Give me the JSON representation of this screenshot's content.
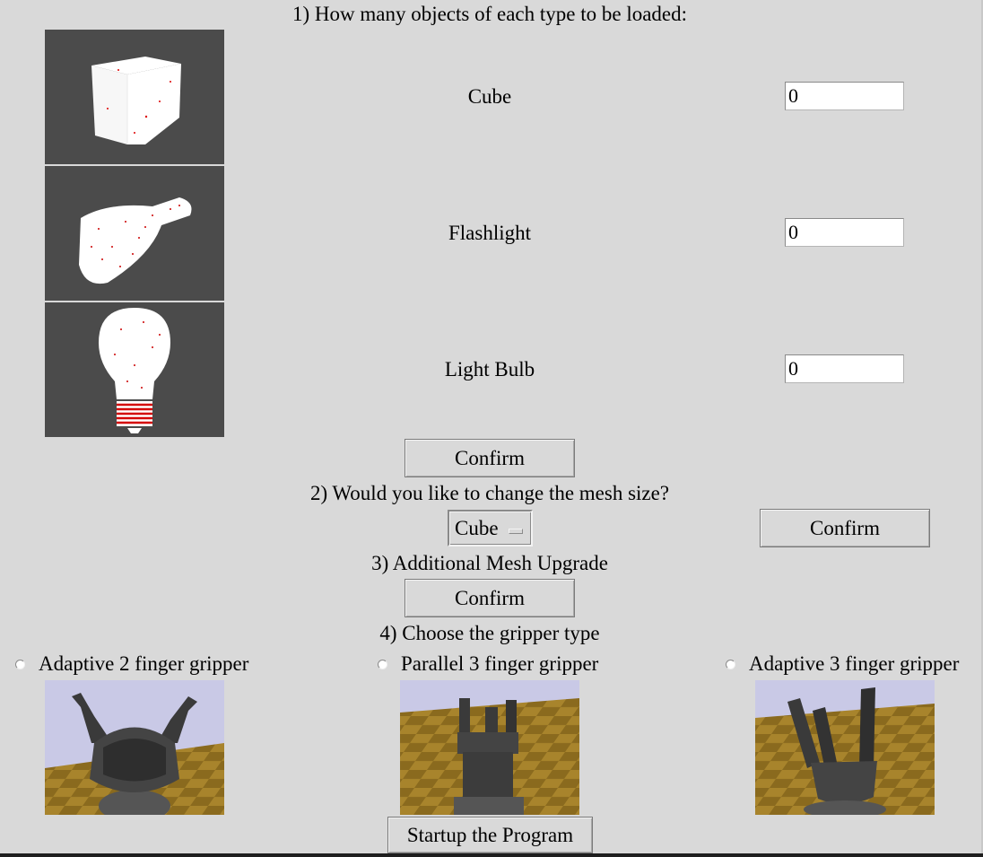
{
  "section1": {
    "heading": "1) How many objects of each type to be loaded:",
    "objects": [
      {
        "label": "Cube",
        "value": "0",
        "icon": "cube-icon"
      },
      {
        "label": "Flashlight",
        "value": "0",
        "icon": "flashlight-icon"
      },
      {
        "label": "Light Bulb",
        "value": "0",
        "icon": "lightbulb-icon"
      }
    ],
    "confirm_label": "Confirm"
  },
  "section2": {
    "heading": "2) Would you like to change the mesh size?",
    "selected": "Cube",
    "confirm_label": "Confirm"
  },
  "section3": {
    "heading": "3) Additional Mesh Upgrade",
    "confirm_label": "Confirm"
  },
  "section4": {
    "heading": "4) Choose the gripper type",
    "grippers": [
      {
        "label": "Adaptive 2 finger gripper",
        "icon": "adaptive-2-finger-gripper-image"
      },
      {
        "label": "Parallel 3 finger gripper",
        "icon": "parallel-3-finger-gripper-image"
      },
      {
        "label": "Adaptive 3 finger gripper",
        "icon": "adaptive-3-finger-gripper-image"
      }
    ]
  },
  "startup_label": "Startup the Program",
  "colors": {
    "background": "#d9d9d9",
    "thumb_bg": "#4b4b4b",
    "sky": "#c9c9e6",
    "floor_dark": "#8a6a1e",
    "floor_light": "#a8842c",
    "gripper": "#3a3a3a"
  }
}
